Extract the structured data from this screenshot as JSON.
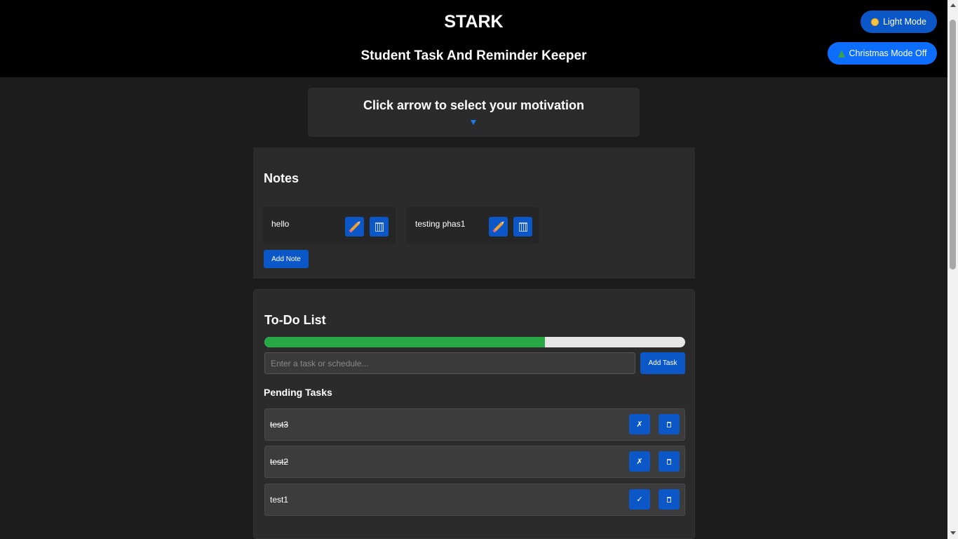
{
  "header": {
    "title": "STARK",
    "subtitle": "Student Task And Reminder Keeper",
    "light_mode_label": "Light Mode",
    "christmas_mode_label": "Christmas Mode Off"
  },
  "motivation": {
    "title": "Click arrow to select your motivation"
  },
  "notes": {
    "title": "Notes",
    "items": [
      {
        "text": "hello"
      },
      {
        "text": "testing phas1"
      }
    ],
    "add_label": "Add Note"
  },
  "todo": {
    "title": "To-Do List",
    "progress_percent": 66.7,
    "input_placeholder": "Enter a task or schedule...",
    "add_label": "Add Task",
    "pending_title": "Pending Tasks",
    "tasks": [
      {
        "text": "test3",
        "done": true,
        "toggle_symbol": "✗"
      },
      {
        "text": "test2",
        "done": true,
        "toggle_symbol": "✗"
      },
      {
        "text": "test1",
        "done": false,
        "toggle_symbol": "✓"
      }
    ]
  },
  "colors": {
    "accent": "#0b57c7",
    "progress": "#28a745",
    "background": "#1c1c1c",
    "panel": "#2b2b2b"
  }
}
